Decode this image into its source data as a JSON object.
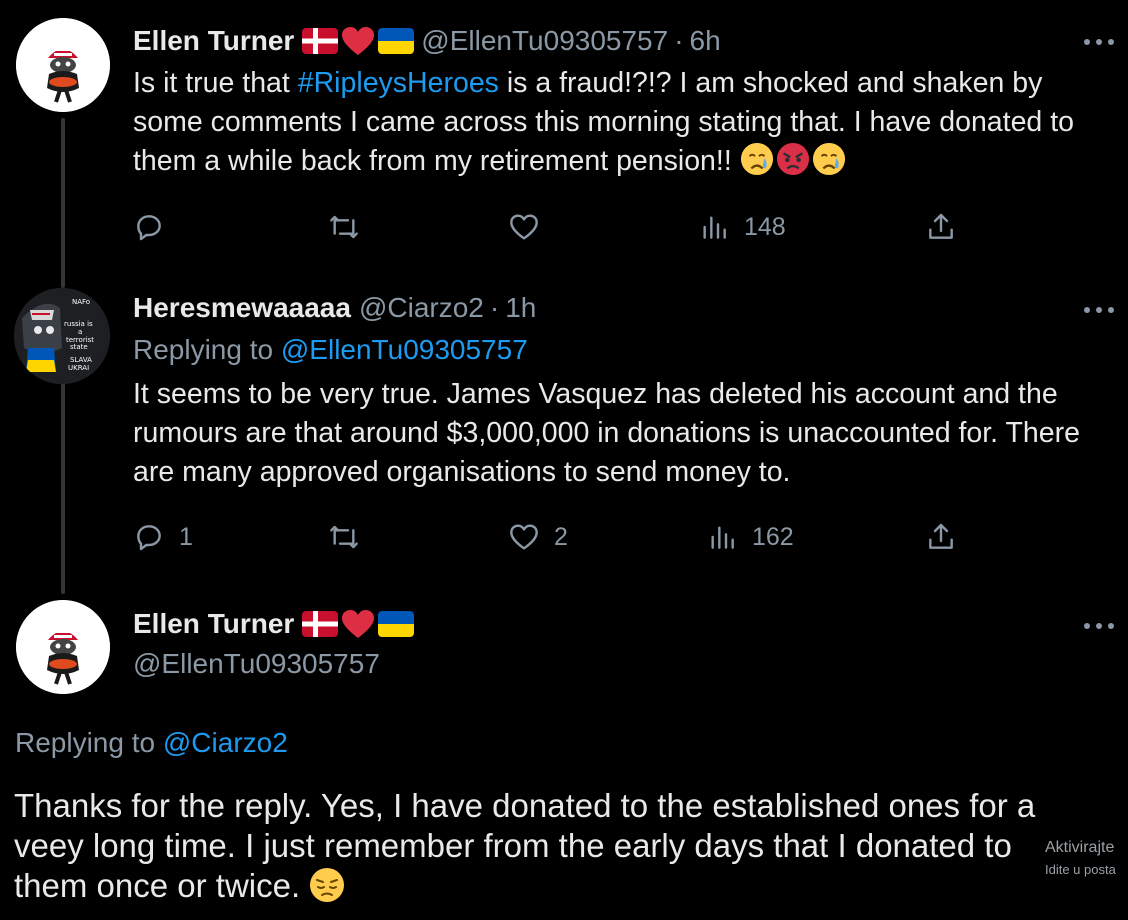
{
  "tweet1": {
    "author_name": "Ellen Turner",
    "author_handle": "@EllenTu09305757",
    "separator": "·",
    "time": "6h",
    "text_before": "Is it true that ",
    "hashtag": "#RipleysHeroes",
    "text_after": " is a fraud!?!? I am shocked and shaken by some comments I came across this morning stating that. I have donated to them a while back from my retirement pension!! ",
    "emojis": [
      "crying-face",
      "angry-face",
      "crying-face"
    ],
    "stats": {
      "replies": "",
      "retweets": "",
      "likes": "",
      "views": "148"
    }
  },
  "tweet2": {
    "author_name": "Heresmewaaaaa",
    "author_handle": "@Ciarzo2",
    "separator": "·",
    "time": "1h",
    "replying_prefix": "Replying to ",
    "replying_handle": "@EllenTu09305757",
    "text": "It seems to be very true. James Vasquez has deleted his account and the rumours are that around $3,000,000 in donations is unaccounted for. There are many approved organisations to send money to.",
    "avatar_text": [
      "NAFo",
      "russia is",
      "a",
      "terrorist",
      "state",
      "SLAVA",
      "UKRAI"
    ],
    "stats": {
      "replies": "1",
      "retweets": "",
      "likes": "2",
      "views": "162"
    }
  },
  "tweet3": {
    "author_name": "Ellen Turner",
    "author_handle": "@EllenTu09305757",
    "replying_prefix": "Replying to ",
    "replying_handle": "@Ciarzo2",
    "text_line1": "Thanks for the reply. Yes, I have donated to the established ones for a",
    "text_line2": "veey long time. I just remember from the early days that I donated to",
    "text_line3": "them once or twice. ",
    "emoji": "pensive-face"
  },
  "watermark": {
    "line1": "Aktivirajte",
    "line2": "Idite u posta"
  },
  "colors": {
    "background": "#000000",
    "text": "#e7e9ea",
    "secondary": "#8b98a5",
    "link": "#1d9bf0",
    "thread_line": "#333639"
  },
  "icons": [
    "reply-icon",
    "retweet-icon",
    "like-icon",
    "views-icon",
    "share-icon",
    "more-icon",
    "denmark-flag-icon",
    "heart-icon",
    "ukraine-flag-icon"
  ]
}
